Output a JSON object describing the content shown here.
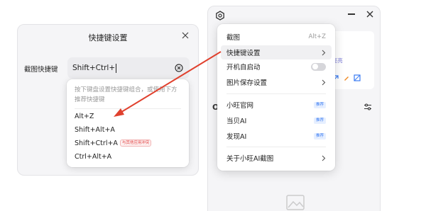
{
  "dialog": {
    "title": "快捷键设置",
    "row_label": "截图快捷键",
    "input_value": "Shift+Ctrl+",
    "hint": "按下键盘设置快捷键组合，或使用下方推荐快捷键",
    "suggestions": [
      {
        "label": "Alt+Z",
        "conflict": ""
      },
      {
        "label": "Shift+Alt+A",
        "conflict": ""
      },
      {
        "label": "Shift+Ctrl+A",
        "conflict": "与其他应用冲突"
      },
      {
        "label": "Ctrl+Alt+A",
        "conflict": ""
      }
    ]
  },
  "app": {
    "card_text": "5亮亮"
  },
  "menu": {
    "items": [
      {
        "label": "截图",
        "shortcut": "Alt+Z"
      },
      {
        "label": "快捷键设置"
      },
      {
        "label": "开机自启动",
        "toggle_on": false
      },
      {
        "label": "图片保存设置"
      },
      {
        "label": "小旺官网",
        "badge": "推荐"
      },
      {
        "label": "当贝AI",
        "badge": "推荐"
      },
      {
        "label": "发现AI",
        "badge": "推荐"
      },
      {
        "label": "关于小旺AI截图"
      }
    ]
  },
  "colors": {
    "arrow": "#e0412e",
    "accent_blue": "#3b7cf2",
    "conflict_red": "#e34a4a"
  }
}
